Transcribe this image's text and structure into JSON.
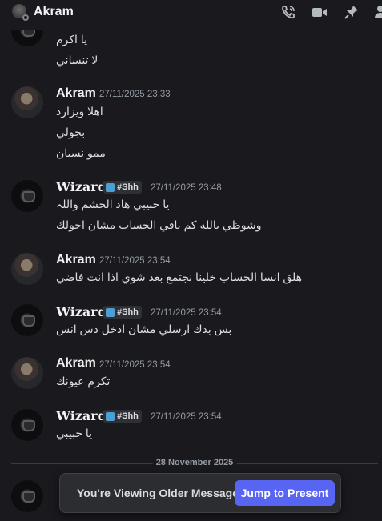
{
  "header": {
    "title": "Akram"
  },
  "messages": [
    {
      "type": "continued",
      "lines": [
        "يا اكرم",
        "لا تنساني"
      ]
    },
    {
      "author": "Akram",
      "timestamp": "27/11/2025 23:33",
      "lines": [
        "اهلا ويزارد",
        "بجولي",
        "ممو نسيان"
      ]
    },
    {
      "author": "Wizard",
      "tag": "#Shh",
      "timestamp": "27/11/2025 23:48",
      "lines": [
        "يا حبيبي هاد الحشم واللہ",
        "وشوظي بالله كم باقي الحساب مشان احولك"
      ]
    },
    {
      "author": "Akram",
      "timestamp": "27/11/2025 23:54",
      "lines": [
        "هلق انسا الحساب خلينا نجتمع بعد شوي اذا انت فاضي"
      ]
    },
    {
      "author": "Wizard",
      "tag": "#Shh",
      "timestamp": "27/11/2025 23:54",
      "lines": [
        "بس بدك ارسلي مشان ادخل دس انس"
      ]
    },
    {
      "author": "Akram",
      "timestamp": "27/11/2025 23:54",
      "lines": [
        "تكرم عيونك"
      ]
    },
    {
      "author": "Wizard",
      "tag": "#Shh",
      "timestamp": "27/11/2025 23:54",
      "lines": [
        "يا حبيبي"
      ]
    }
  ],
  "date_divider": "28 November 2025",
  "older_banner": {
    "label": "You're Viewing Older Messages",
    "button": "Jump to Present"
  },
  "colors": {
    "accent": "#5865f2",
    "background": "#1a1a1e",
    "tag_icon": "#4b9fd5"
  },
  "icons": [
    "phone-icon",
    "video-icon",
    "pin-icon",
    "members-icon"
  ]
}
